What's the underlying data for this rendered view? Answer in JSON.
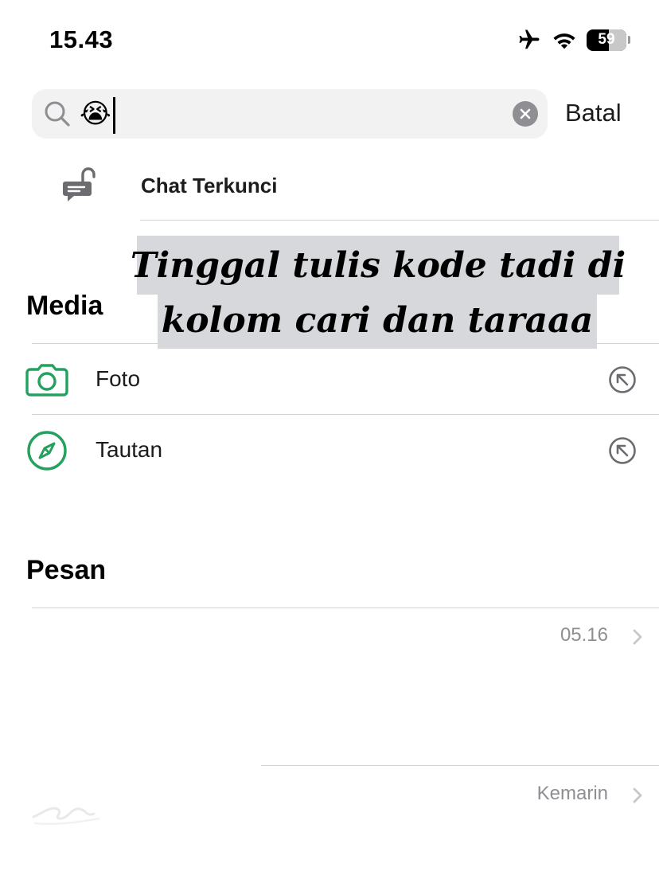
{
  "status_bar": {
    "time": "15.43",
    "battery_level": "59",
    "icons": [
      "airplane-icon",
      "wifi-icon",
      "battery-icon"
    ]
  },
  "search": {
    "query": "😭",
    "cancel_label": "Batal"
  },
  "locked_chats": {
    "label": "Chat Terkunci"
  },
  "overlay": {
    "line1": "Tinggal tulis kode tadi di",
    "line2": "kolom cari dan taraaa"
  },
  "media": {
    "title": "Media",
    "items": [
      {
        "label": "Foto",
        "icon": "camera-icon"
      },
      {
        "label": "Tautan",
        "icon": "compass-icon"
      }
    ]
  },
  "messages": {
    "title": "Pesan",
    "items": [
      {
        "time": "05.16"
      },
      {
        "time": "Kemarin"
      }
    ]
  },
  "colors": {
    "accent_green": "#25A15F",
    "secondary_text": "#8E8E93",
    "divider": "#D1D1D6",
    "search_bg": "#F2F2F2"
  }
}
